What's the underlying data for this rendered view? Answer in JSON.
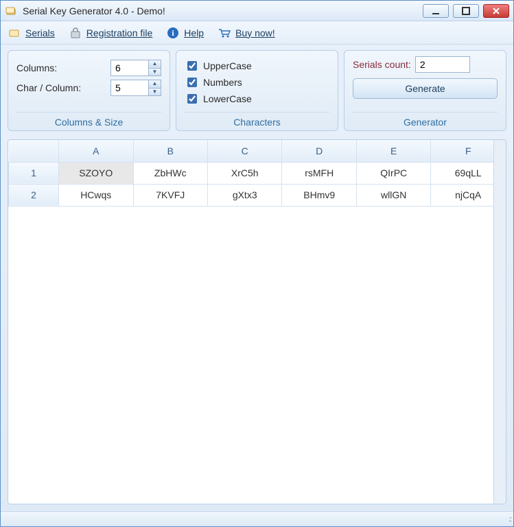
{
  "title": "Serial Key Generator 4.0 - Demo!",
  "toolbar": {
    "serials": "Serials",
    "registration": "Registration file",
    "help": "Help",
    "buy": "Buy now!"
  },
  "panels": {
    "columns_size": {
      "columns_label": "Columns:",
      "columns_value": "6",
      "char_label": "Char / Column:",
      "char_value": "5",
      "caption": "Columns & Size"
    },
    "characters": {
      "uppercase_label": "UpperCase",
      "uppercase_checked": true,
      "numbers_label": "Numbers",
      "numbers_checked": true,
      "lowercase_label": "LowerCase",
      "lowercase_checked": true,
      "caption": "Characters"
    },
    "generator": {
      "count_label": "Serials count:",
      "count_value": "2",
      "generate_label": "Generate",
      "caption": "Generator"
    }
  },
  "grid": {
    "headers": [
      "A",
      "B",
      "C",
      "D",
      "E",
      "F"
    ],
    "rows": [
      {
        "n": "1",
        "cells": [
          "SZOYO",
          "ZbHWc",
          "XrC5h",
          "rsMFH",
          "QIrPC",
          "69qLL"
        ]
      },
      {
        "n": "2",
        "cells": [
          "HCwqs",
          "7KVFJ",
          "gXtx3",
          "BHmv9",
          "wllGN",
          "njCqA"
        ]
      }
    ]
  }
}
